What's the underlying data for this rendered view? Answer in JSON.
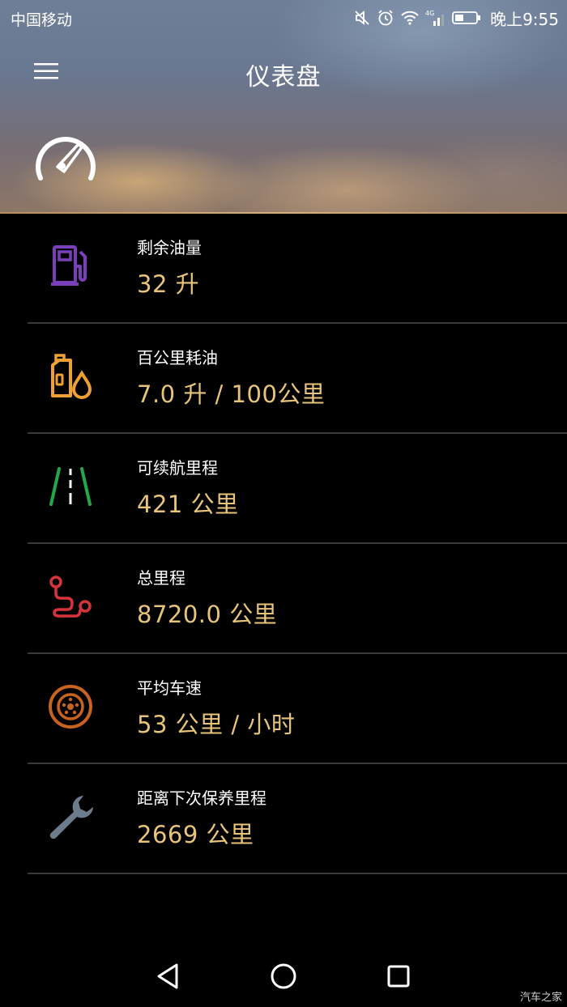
{
  "status_bar": {
    "carrier": "中国移动",
    "network": "4G",
    "time": "晚上9:55"
  },
  "header": {
    "title": "仪表盘"
  },
  "metrics": [
    {
      "label": "剩余油量",
      "value": "32 升",
      "icon": "fuel-pump-icon",
      "color": "#7a3fb8"
    },
    {
      "label": "百公里耗油",
      "value": "7.0 升 / 100公里",
      "icon": "oil-can-icon",
      "color": "#f0a030"
    },
    {
      "label": "可续航里程",
      "value": "421 公里",
      "icon": "road-icon",
      "color": "#22a84a"
    },
    {
      "label": "总里程",
      "value": "8720.0 公里",
      "icon": "route-icon",
      "color": "#d8323a"
    },
    {
      "label": "平均车速",
      "value": "53 公里 / 小时",
      "icon": "wheel-icon",
      "color": "#c8621f"
    },
    {
      "label": "距离下次保养里程",
      "value": "2669 公里",
      "icon": "wrench-icon",
      "color": "#6d7c8c"
    }
  ],
  "watermark": "汽车之家",
  "colors": {
    "value_text": "#e8c47a",
    "divider": "#3a3a3a",
    "background": "#000000"
  }
}
